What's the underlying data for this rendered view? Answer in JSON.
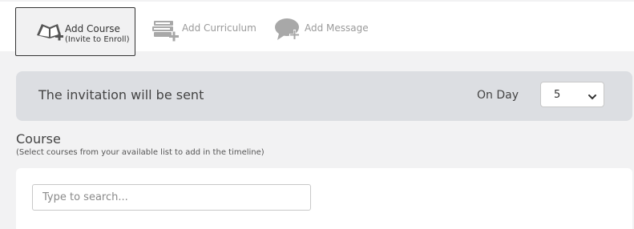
{
  "tabs": {
    "add_course": {
      "title": "Add Course",
      "subtitle": "(Invite to Enroll)"
    },
    "add_curriculum": {
      "title": "Add Curriculum"
    },
    "add_message": {
      "title": "Add Message"
    }
  },
  "invitation": {
    "text": "The invitation will be sent",
    "on_day_label": "On Day",
    "day_value": "5"
  },
  "course": {
    "title": "Course",
    "subtitle": "(Select courses from your available list to add in the timeline)",
    "search_placeholder": "Type to search..."
  },
  "colors": {
    "invite_bar": "#dcdee2",
    "page_bg": "#f2f2f3",
    "icon_dark": "#555555",
    "icon_light": "#a8a8a8"
  }
}
